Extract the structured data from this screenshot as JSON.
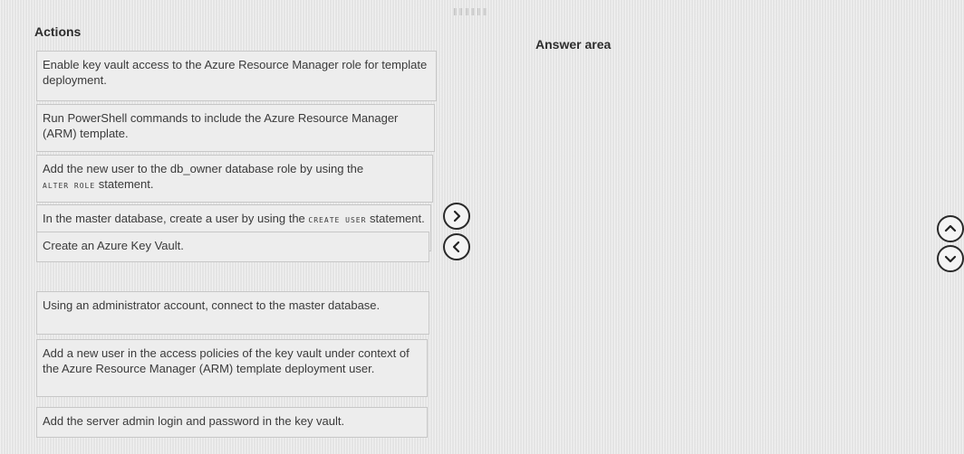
{
  "header": {
    "dots": "‖‖‖‖‖‖"
  },
  "actions_title": "Actions",
  "answer_title": "Answer area",
  "actions": [
    {
      "text": "Enable key vault access to the Azure Resource Manager role for template deployment."
    },
    {
      "text": "Run PowerShell commands to include the Azure Resource Manager (ARM) template."
    },
    {
      "text": "Add the new user to the db_owner database role by using the",
      "mono": "ALTER ROLE",
      "tail": " statement."
    },
    {
      "text": "In the master database, create a user by using the",
      "mono": "CREATE USER",
      "tail": " statement."
    },
    {
      "text": "Create an Azure Key Vault."
    },
    {
      "text": "Using an administrator account, connect to the master database."
    },
    {
      "text": "Add a new user in the access policies of the key vault under context of the Azure Resource Manager (ARM) template deployment user."
    },
    {
      "text": "Add the server admin login and password in the key vault."
    }
  ],
  "controls": {
    "move_right": "move-right-icon",
    "move_left": "move-left-icon",
    "move_up": "move-up-icon",
    "move_down": "move-down-icon"
  }
}
